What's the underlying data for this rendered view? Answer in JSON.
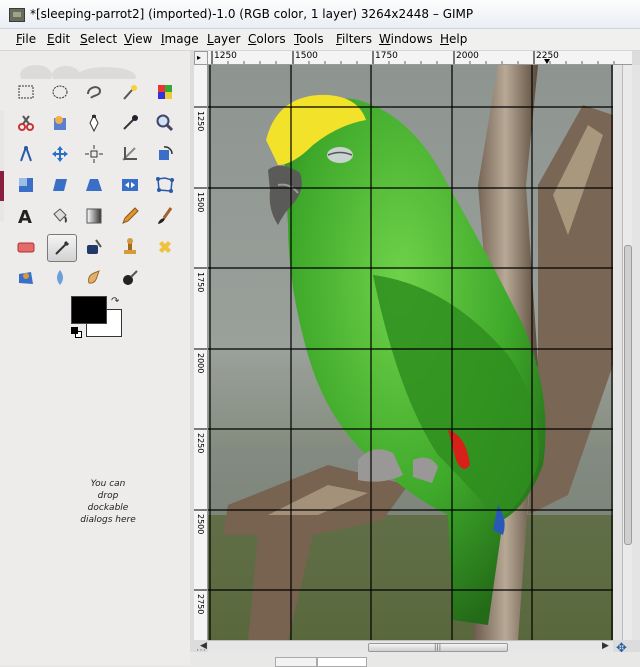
{
  "window": {
    "title": "*[sleeping-parrot2] (imported)-1.0 (RGB color, 1 layer) 3264x2448 – GIMP"
  },
  "menu": {
    "items": [
      "File",
      "Edit",
      "Select",
      "View",
      "Image",
      "Layer",
      "Colors",
      "Tools",
      "Filters",
      "Windows",
      "Help"
    ]
  },
  "toolbox": {
    "tools": [
      "rect-select",
      "ellipse-select",
      "free-select",
      "fuzzy-select",
      "select-by-color",
      "scissors-select",
      "foreground-select",
      "paths",
      "color-picker",
      "zoom",
      "measure",
      "move",
      "align",
      "crop",
      "rotate",
      "scale",
      "shear",
      "perspective",
      "flip",
      "cage-transform",
      "text",
      "bucket-fill",
      "blend",
      "pencil",
      "paintbrush",
      "eraser",
      "airbrush",
      "ink",
      "clone",
      "heal",
      "perspective-clone",
      "blur",
      "smudge",
      "dodge-burn"
    ],
    "active_tool": "airbrush",
    "foreground_color": "#000000",
    "background_color": "#ffffff",
    "drop_hint": "You can drop dockable dialogs here"
  },
  "canvas": {
    "ruler_corner_glyph": "▸",
    "horizontal_ruler_labels": [
      "1250",
      "1500",
      "1750",
      "2000",
      "2250"
    ],
    "vertical_ruler_labels": [
      "1250",
      "1500",
      "1750",
      "2000",
      "2250",
      "2500",
      "2750"
    ],
    "grid_color": "#000000",
    "image_name": "sleeping-parrot2"
  },
  "scrollbar": {
    "grip_glyph": "|||",
    "left_arrow": "◀",
    "right_arrow": "▶"
  },
  "navigation_icon": "✥"
}
